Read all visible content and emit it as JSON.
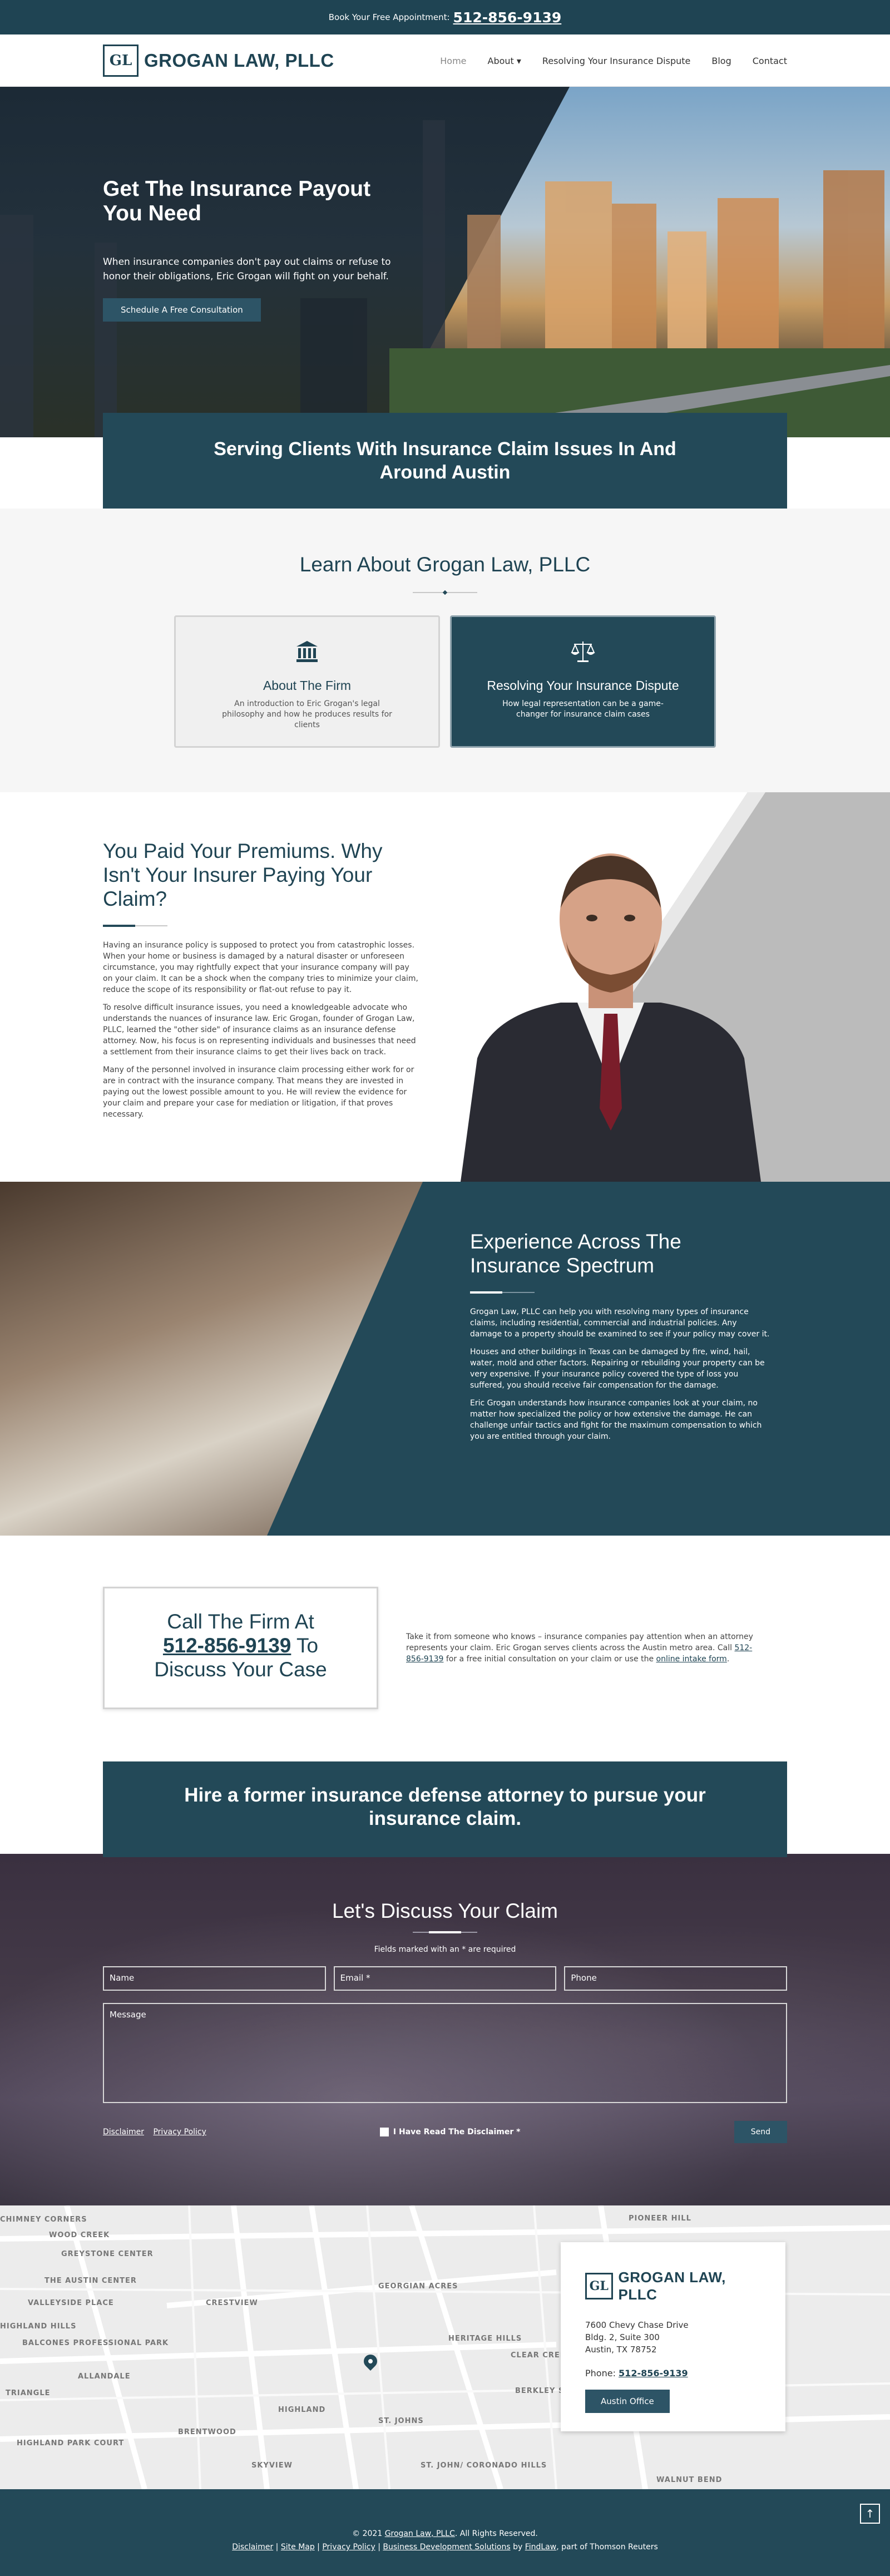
{
  "topbar": {
    "text": "Book Your Free Appointment:",
    "phone": "512-856-9139"
  },
  "header": {
    "logo_mark": "GL",
    "logo_text": "GROGAN LAW, PLLC",
    "nav": [
      "Home",
      "About ▾",
      "Resolving Your Insurance Dispute",
      "Blog",
      "Contact"
    ]
  },
  "hero": {
    "title": "Get The Insurance Payout You Need",
    "text": "When insurance companies don't pay out claims or refuse to honor their obligations, Eric Grogan will fight on your behalf.",
    "cta": "Schedule A Free Consultation"
  },
  "serve_banner": "Serving Clients With Insurance Claim Issues In And Around Austin",
  "learn": {
    "title": "Learn About Grogan Law, PLLC",
    "cards": [
      {
        "icon": "courthouse-icon",
        "title": "About The Firm",
        "text": "An introduction to Eric Grogan's legal philosophy and how he produces results for clients"
      },
      {
        "icon": "scales-icon",
        "title": "Resolving Your Insurance Dispute",
        "text": "How legal representation can be a game-changer for insurance claim cases"
      }
    ]
  },
  "premiums": {
    "title": "You Paid Your Premiums. Why Isn't Your Insurer Paying Your Claim?",
    "paragraphs": [
      "Having an insurance policy is supposed to protect you from catastrophic losses. When your home or business is damaged by a natural disaster or unforeseen circumstance, you may rightfully expect that your insurance company will pay on your claim. It can be a shock when the company tries to minimize your claim, reduce the scope of its responsibility or flat-out refuse to pay it.",
      "To resolve difficult insurance issues, you need a knowledgeable advocate who understands the nuances of insurance law. Eric Grogan, founder of Grogan Law, PLLC, learned the \"other side\" of insurance claims as an insurance defense attorney. Now, his focus is on representing individuals and businesses that need a settlement from their insurance claims to get their lives back on track.",
      "Many of the personnel involved in insurance claim processing either work for or are in contract with the insurance company. That means they are invested in paying out the lowest possible amount to you. He will review the evidence for your claim and prepare your case for mediation or litigation, if that proves necessary."
    ]
  },
  "experience": {
    "title": "Experience Across The Insurance Spectrum",
    "paragraphs": [
      "Grogan Law, PLLC  can help you with resolving many types of insurance claims, including residential, commercial and industrial policies. Any damage to a property should be examined to see if your policy may cover it.",
      "Houses and other buildings in Texas can be damaged by fire, wind, hail, water, mold and other factors. Repairing or rebuilding your property can be very expensive. If your insurance policy covered the type of loss you suffered, you should receive fair compensation for the damage.",
      "Eric Grogan understands how insurance companies look at your claim, no matter how specialized the policy or how extensive the damage. He can challenge unfair tactics and fight for the maximum compensation to which you are entitled through your claim."
    ]
  },
  "call": {
    "line1": "Call The Firm At",
    "phone": "512-856-9139",
    "line2": "To",
    "line3": "Discuss Your Case",
    "desc_before": "Take it from someone who knows – insurance companies pay attention when an attorney represents your claim. Eric Grogan serves clients across the Austin metro area. Call ",
    "desc_phone": "512-856-9139",
    "desc_mid": " for a free initial consultation on your claim or use the ",
    "desc_link": "online intake form",
    "desc_end": "."
  },
  "hire_banner": "Hire a former insurance defense attorney to pursue your insurance claim.",
  "form": {
    "title": "Let's Discuss Your Claim",
    "required_note": "Fields marked with an * are required",
    "name_placeholder": "Name",
    "email_placeholder": "Email *",
    "phone_placeholder": "Phone",
    "message_placeholder": "Message",
    "disclaimer_link": "Disclaimer",
    "privacy_link": "Privacy Policy",
    "checkbox_label": "I Have Read The Disclaimer *",
    "send": "Send"
  },
  "map": {
    "labels": [
      "CHIMNEY CORNERS",
      "WOOD CREEK",
      "GREYSTONE CENTER",
      "THE AUSTIN CENTER",
      "VALLEYSIDE PLACE",
      "HIGHLAND HILLS",
      "BALCONES PROFESSIONAL PARK",
      "ALLANDALE",
      "TRIANGLE",
      "CRESTVIEW",
      "GEORGIAN ACRES",
      "HERITAGE HILLS",
      "CLEAR CREEK ESTATES",
      "BERKLEY SQUARE",
      "HIGHLAND",
      "BRENTWOOD",
      "ST. JOHNS",
      "ST. JOHN/ CORONADO HILLS",
      "SKYVIEW",
      "HIGHLAND PARK COURT",
      "PIONEER HILL",
      "WALNUT BEND"
    ],
    "office": {
      "logo_mark": "GL",
      "logo_text": "GROGAN LAW, PLLC",
      "address1": "7600 Chevy Chase Drive",
      "address2": "Bldg. 2, Suite 300",
      "address3": "Austin, TX 78752",
      "phone_label": "Phone:",
      "phone": "512-856-9139",
      "button": "Austin Office"
    }
  },
  "footer": {
    "line1_before": "© 2021 ",
    "line1_link": "Grogan Law, PLLC",
    "line1_after": ". All Rights Reserved.",
    "links": [
      "Disclaimer",
      "Site Map",
      "Privacy Policy",
      "Business Development Solutions"
    ],
    "by": "by",
    "findlaw": "FindLaw",
    "suffix": ", part of Thomson Reuters",
    "to_top_icon": "arrow-up-icon"
  },
  "colors": {
    "primary": "#234958",
    "accent": "#2d5466"
  }
}
